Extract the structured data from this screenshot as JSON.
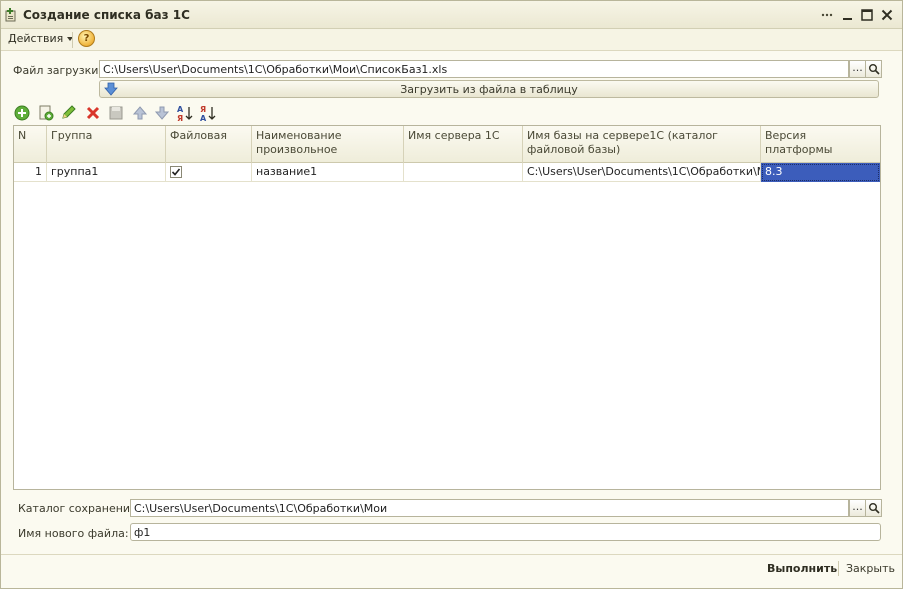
{
  "window": {
    "title": "Создание списка баз 1С"
  },
  "menu": {
    "actions_label": "Действия",
    "help_glyph": "?"
  },
  "file_load": {
    "label": "Файл загрузки:",
    "value": "C:\\Users\\User\\Documents\\1C\\Обработки\\Мои\\СписокБаз1.xls",
    "select_glyph": "...",
    "load_button_label": "Загрузить из файла в таблицу"
  },
  "toolbar": {
    "icons": [
      "add-icon",
      "copy-icon",
      "edit-icon",
      "delete-icon",
      "save-icon",
      "move-up-icon",
      "move-down-icon",
      "sort-asc-icon",
      "sort-desc-icon"
    ]
  },
  "table": {
    "columns": [
      "N",
      "Группа",
      "Файловая",
      "Наименование произвольное",
      "Имя сервера 1С",
      "Имя базы на сервере1С (каталог файловой базы)",
      "Версия платформы"
    ],
    "rows": [
      {
        "n": "1",
        "group": "группа1",
        "file_based": true,
        "name": "название1",
        "server": "",
        "base_name": "C:\\Users\\User\\Documents\\1C\\Обработки\\М...",
        "platform": "8.3"
      }
    ]
  },
  "save_catalog": {
    "label": "Каталог сохранения:",
    "value": "C:\\Users\\User\\Documents\\1C\\Обработки\\Мои",
    "select_glyph": "..."
  },
  "new_file": {
    "label": "Имя нового файла:",
    "value": "ф1"
  },
  "footer": {
    "run_label": "Выполнить",
    "close_label": "Закрыть"
  },
  "colors": {
    "selection": "#3c5dbb",
    "background": "#fbfaf0"
  }
}
